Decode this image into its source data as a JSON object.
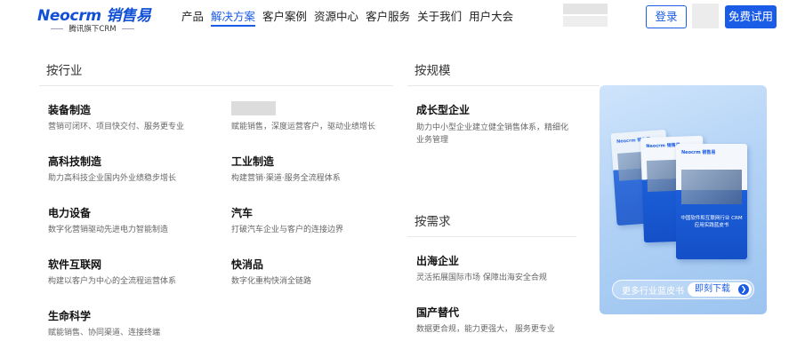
{
  "header": {
    "logo_main": "Neocrm 销售易",
    "logo_sub": "腾讯旗下CRM",
    "nav": [
      "产品",
      "解决方案",
      "客户案例",
      "资源中心",
      "客户服务",
      "关于我们",
      "用户大会"
    ],
    "active_nav": "解决方案",
    "login_label": "登录",
    "trial_label": "免费试用"
  },
  "industry": {
    "title": "按行业",
    "items": [
      {
        "title": "装备制造",
        "desc": "营销可闭环、项目快交付、服务更专业"
      },
      {
        "title": "",
        "desc": "赋能销售，深度运营客户，驱动业绩增长"
      },
      {
        "title": "高科技制造",
        "desc": "助力高科技企业国内外业绩稳步增长"
      },
      {
        "title": "工业制造",
        "desc": "构建营销·渠道·服务全流程体系"
      },
      {
        "title": "电力设备",
        "desc": "数字化营销驱动先进电力智能制造"
      },
      {
        "title": "汽车",
        "desc": "打破汽车企业与客户的连接边界"
      },
      {
        "title": "软件互联网",
        "desc": "构建以客户为中心的全流程运营体系"
      },
      {
        "title": "快消品",
        "desc": "数字化重构快消全链路"
      },
      {
        "title": "生命科学",
        "desc": "赋能销售、协同渠道、连接终端"
      }
    ]
  },
  "scale": {
    "title": "按规模",
    "items": [
      {
        "title": "成长型企业",
        "desc": "助力中小型企业建立健全销售体系，精细化业务管理"
      }
    ]
  },
  "demand": {
    "title": "按需求",
    "items": [
      {
        "title": "出海企业",
        "desc": "灵活拓展国际市场 保障出海安全合规"
      },
      {
        "title": "国产替代",
        "desc": "数据更合规，能力更强大， 服务更专业"
      }
    ]
  },
  "promo": {
    "book_brand": "Neocrm 销售易",
    "book_caption": "中国软件和互联网行业 CRM应用实践蓝皮书",
    "more_label": "更多行业蓝皮书",
    "download_label": "即刻下载",
    "arrow_icon": "chevron-right-icon",
    "accent_color": "#1a5ce6"
  }
}
